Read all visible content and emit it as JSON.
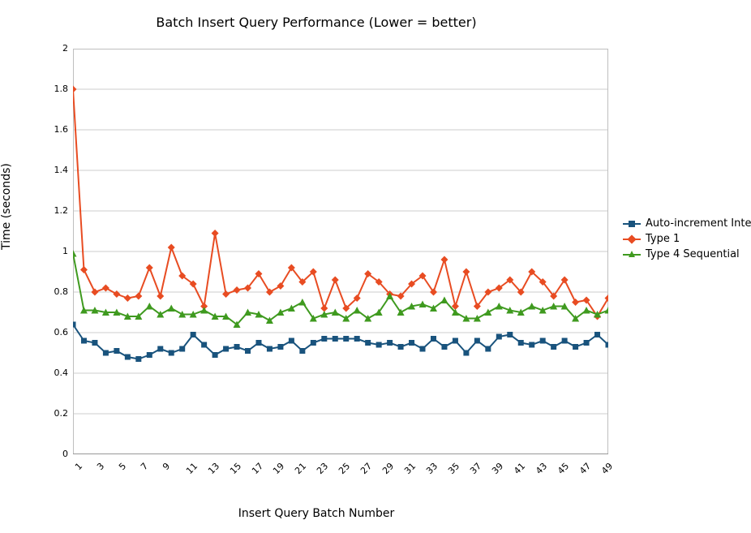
{
  "chart_data": {
    "type": "line",
    "title": "Batch Insert Query Performance (Lower = better)",
    "xlabel": "Insert Query Batch Number",
    "ylabel": "Time (seconds)",
    "xlim": [
      1,
      50
    ],
    "ylim": [
      0,
      2
    ],
    "xticks": [
      1,
      3,
      5,
      7,
      9,
      11,
      13,
      15,
      17,
      19,
      21,
      23,
      25,
      27,
      29,
      31,
      33,
      35,
      37,
      39,
      41,
      43,
      45,
      47,
      49
    ],
    "yticks": [
      0,
      0.2,
      0.4,
      0.6,
      0.8,
      1,
      1.2,
      1.4,
      1.6,
      1.8,
      2
    ],
    "grid": true,
    "legend_position": "right",
    "x": [
      1,
      2,
      3,
      4,
      5,
      6,
      7,
      8,
      9,
      10,
      11,
      12,
      13,
      14,
      15,
      16,
      17,
      18,
      19,
      20,
      21,
      22,
      23,
      24,
      25,
      26,
      27,
      28,
      29,
      30,
      31,
      32,
      33,
      34,
      35,
      36,
      37,
      38,
      39,
      40,
      41,
      42,
      43,
      44,
      45,
      46,
      47,
      48,
      49,
      50
    ],
    "series": [
      {
        "name": "Auto-increment Integer",
        "color": "#19537d",
        "marker": "square",
        "values": [
          0.64,
          0.56,
          0.55,
          0.5,
          0.51,
          0.48,
          0.47,
          0.49,
          0.52,
          0.5,
          0.52,
          0.59,
          0.54,
          0.49,
          0.52,
          0.53,
          0.51,
          0.55,
          0.52,
          0.53,
          0.56,
          0.51,
          0.55,
          0.57,
          0.57,
          0.57,
          0.57,
          0.55,
          0.54,
          0.55,
          0.53,
          0.55,
          0.52,
          0.57,
          0.53,
          0.56,
          0.5,
          0.56,
          0.52,
          0.58,
          0.59,
          0.55,
          0.54,
          0.56,
          0.53,
          0.56,
          0.53,
          0.55,
          0.59,
          0.54
        ]
      },
      {
        "name": "Type 1",
        "color": "#e84c22",
        "marker": "diamond",
        "values": [
          1.8,
          0.91,
          0.8,
          0.82,
          0.79,
          0.77,
          0.78,
          0.92,
          0.78,
          1.02,
          0.88,
          0.84,
          0.73,
          1.09,
          0.79,
          0.81,
          0.82,
          0.89,
          0.8,
          0.83,
          0.92,
          0.85,
          0.9,
          0.72,
          0.86,
          0.72,
          0.77,
          0.89,
          0.85,
          0.79,
          0.78,
          0.84,
          0.88,
          0.8,
          0.96,
          0.73,
          0.9,
          0.73,
          0.8,
          0.82,
          0.86,
          0.8,
          0.9,
          0.85,
          0.78,
          0.86,
          0.75,
          0.76,
          0.68,
          0.77
        ]
      },
      {
        "name": "Type 4 Sequential",
        "color": "#3f9a1f",
        "marker": "triangle",
        "values": [
          0.99,
          0.71,
          0.71,
          0.7,
          0.7,
          0.68,
          0.68,
          0.73,
          0.69,
          0.72,
          0.69,
          0.69,
          0.71,
          0.68,
          0.68,
          0.64,
          0.7,
          0.69,
          0.66,
          0.7,
          0.72,
          0.75,
          0.67,
          0.69,
          0.7,
          0.67,
          0.71,
          0.67,
          0.7,
          0.78,
          0.7,
          0.73,
          0.74,
          0.72,
          0.76,
          0.7,
          0.67,
          0.67,
          0.7,
          0.73,
          0.71,
          0.7,
          0.73,
          0.71,
          0.73,
          0.73,
          0.67,
          0.71,
          0.69,
          0.71
        ]
      }
    ]
  }
}
